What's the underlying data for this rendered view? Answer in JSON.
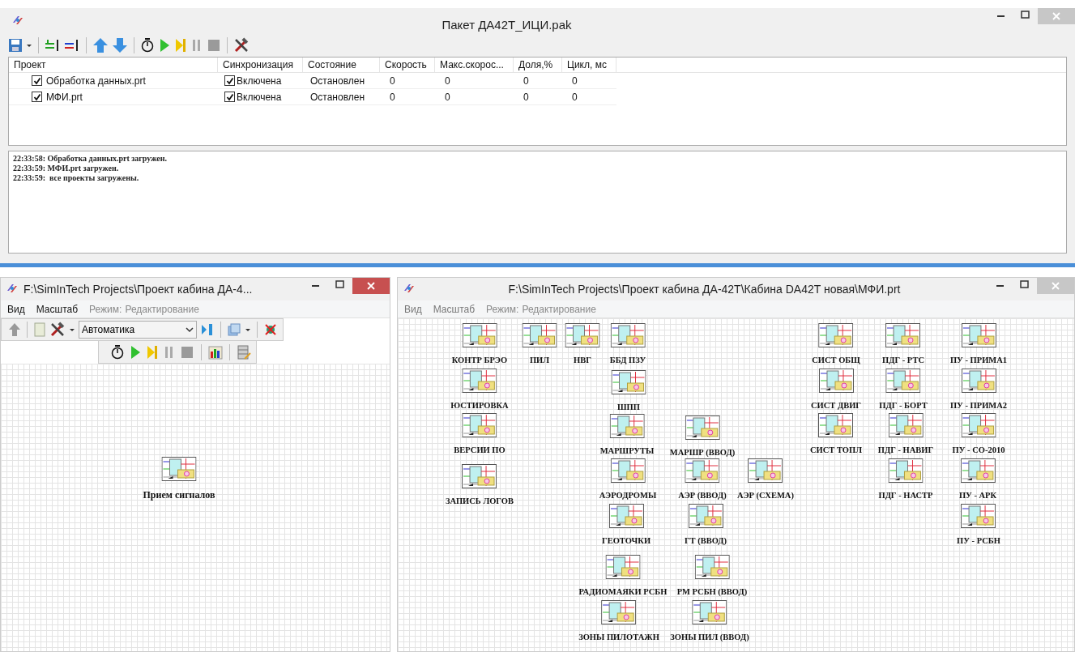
{
  "package_window": {
    "title": "Пакет  ДА42Т_ИЦИ.pak",
    "table": {
      "columns": [
        "Проект",
        "Синхронизация",
        "Состояние",
        "Скорость",
        "Макс.скорос...",
        "Доля,%",
        "Цикл, мс"
      ],
      "rows": [
        {
          "project": "Обработка данных.prt",
          "checked": true,
          "sync_checked": true,
          "sync": "Включена",
          "state": "Остановлен",
          "speed": "0",
          "max_speed": "0",
          "share": "0",
          "cycle": "0"
        },
        {
          "project": "МФИ.prt",
          "checked": true,
          "sync_checked": true,
          "sync": "Включена",
          "state": "Остановлен",
          "speed": "0",
          "max_speed": "0",
          "share": "0",
          "cycle": "0"
        }
      ]
    },
    "log": [
      "22:33:58: Обработка данных.prt загружен.",
      "22:33:59: МФИ.prt загружен.",
      "22:33:59:  все проекты загружены."
    ]
  },
  "project_windows": [
    {
      "title": "F:\\SimInTech Projects\\Проект кабина ДА-4...",
      "active": true,
      "menu": [
        "Вид",
        "Масштаб"
      ],
      "mode_label": "Режим:",
      "mode": "Редактирование",
      "toolbar": true,
      "dropdown": "Автоматика",
      "blocks": [
        {
          "label": "Прием сигналов"
        }
      ]
    },
    {
      "title": "F:\\SimInTech Projects\\Проект кабина ДА-42Т\\Кабина DA42T новая\\МФИ.prt",
      "active": false,
      "menu": [
        "Вид",
        "Масштаб"
      ],
      "mode_label": "Режим:",
      "mode": "Редактирование",
      "toolbar": false,
      "blocks": [
        {
          "label": "КОНТР БРЭО"
        },
        {
          "label": "ПИЛ"
        },
        {
          "label": "НВГ"
        },
        {
          "label": "ББД ПЗУ"
        },
        {
          "label": "ЮСТИРОВКА"
        },
        {
          "label": "ВЕРСИИ ПО"
        },
        {
          "label": "ЗАПИСЬ ЛОГОВ"
        },
        {
          "label": "ШПП"
        },
        {
          "label": "МАРШРУТЫ"
        },
        {
          "label": "МАРШР (ВВОД)"
        },
        {
          "label": "АЭРОДРОМЫ"
        },
        {
          "label": "АЭР (ВВОД)"
        },
        {
          "label": "АЭР (СХЕМА)"
        },
        {
          "label": "ГЕОТОЧКИ"
        },
        {
          "label": "ГТ (ВВОД)"
        },
        {
          "label": "РАДИОМАЯКИ РСБН"
        },
        {
          "label": "РМ РСБН (ВВОД)"
        },
        {
          "label": "ЗОНЫ ПИЛОТАЖН"
        },
        {
          "label": "ЗОНЫ ПИЛ (ВВОД)"
        },
        {
          "label": "СИСТ ОБЩ"
        },
        {
          "label": "ПДГ - РТС"
        },
        {
          "label": "ПУ - ПРИМА1"
        },
        {
          "label": "СИСТ ДВИГ"
        },
        {
          "label": "ПДГ - БОРТ"
        },
        {
          "label": "ПУ - ПРИМА2"
        },
        {
          "label": "СИСТ ТОПЛ"
        },
        {
          "label": "ПДГ - НАВИГ"
        },
        {
          "label": "ПУ - СО-2010"
        },
        {
          "label": "ПДГ - НАСТР"
        },
        {
          "label": "ПУ - АРК"
        },
        {
          "label": "ПУ - РСБН"
        }
      ]
    }
  ]
}
